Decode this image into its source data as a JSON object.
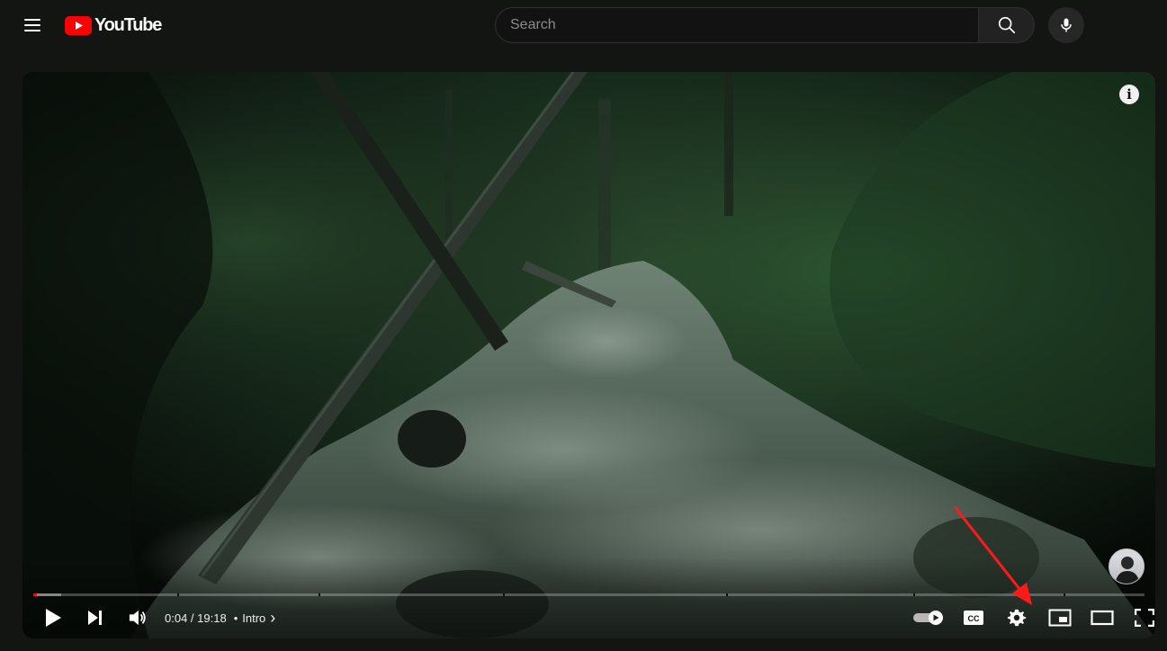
{
  "header": {
    "logo_text": "YouTube",
    "search_placeholder": "Search"
  },
  "player": {
    "time_current": "0:04",
    "time_separator": " / ",
    "time_total": "19:18",
    "chapter_bullet": "•",
    "chapter_title": "Intro",
    "chapter_chevron": "›",
    "info_glyph": "i",
    "cc_label": "CC",
    "progress_played_fraction": 0.0035,
    "progress_loaded_fraction": 0.025
  },
  "icons": {
    "menu": "menu-icon",
    "logo": "youtube-logo-icon",
    "search": "search-icon",
    "mic": "microphone-icon",
    "info": "info-icon",
    "play": "play-icon",
    "next": "next-icon",
    "volume": "volume-icon",
    "autoplay": "autoplay-toggle-icon",
    "subtitles": "subtitles-icon",
    "settings": "gear-icon",
    "miniplayer": "miniplayer-icon",
    "theater": "theater-mode-icon",
    "fullscreen": "fullscreen-icon"
  },
  "colors": {
    "brand_red": "#ff0000",
    "background": "#121512",
    "annotation_arrow": "#ff1a1a"
  }
}
